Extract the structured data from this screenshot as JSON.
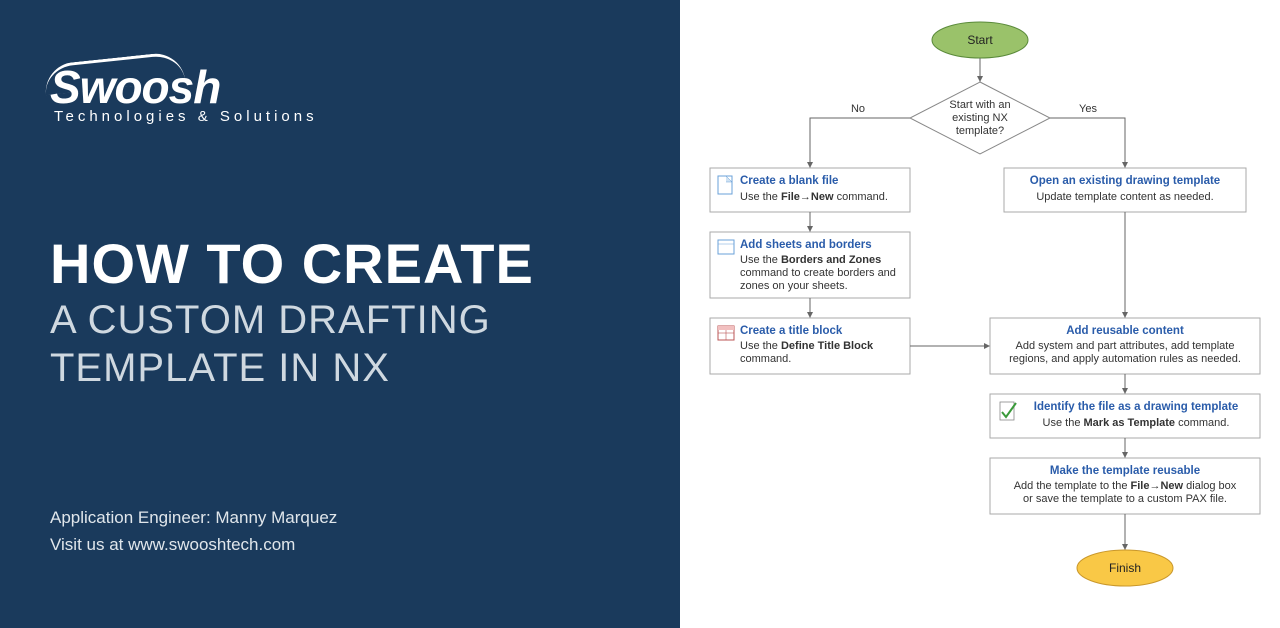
{
  "left": {
    "logo_main": "Swoosh",
    "logo_sub": "Technologies & Solutions",
    "title_line1": "HOW TO CREATE",
    "title_line2": "A CUSTOM DRAFTING TEMPLATE IN NX",
    "footer_line1": "Application Engineer: Manny Marquez",
    "footer_line2": "Visit us at www.swooshtech.com"
  },
  "flowchart": {
    "start_label": "Start",
    "finish_label": "Finish",
    "decision": {
      "line1": "Start with an",
      "line2": "existing NX",
      "line3": "template?"
    },
    "branch_no": "No",
    "branch_yes": "Yes",
    "nodes": {
      "blank": {
        "title": "Create a blank file",
        "body_pre": "Use the ",
        "body_bold": "File→New",
        "body_post": " command."
      },
      "sheets": {
        "title": "Add sheets and borders",
        "body_pre": "Use the ",
        "body_bold": "Borders and Zones",
        "body_post1": "command to create borders and",
        "body_post2": "zones on your sheets."
      },
      "titleblock": {
        "title": "Create a title block",
        "body_pre": "Use the ",
        "body_bold": "Define Title Block",
        "body_post": "command."
      },
      "open": {
        "title": "Open an existing drawing template",
        "body": "Update template content as needed."
      },
      "reusable": {
        "title": "Add reusable content",
        "body1": "Add system and part attributes, add template",
        "body2": "regions, and apply automation rules as needed."
      },
      "identify": {
        "title": "Identify the file as a drawing template",
        "body_pre": "Use the ",
        "body_bold": "Mark as Template",
        "body_post": " command."
      },
      "make": {
        "title": "Make the template reusable",
        "body_pre": "Add the template to the ",
        "body_bold": "File→New",
        "body_post": " dialog box",
        "body2": "or save the template to a custom PAX file."
      }
    }
  }
}
